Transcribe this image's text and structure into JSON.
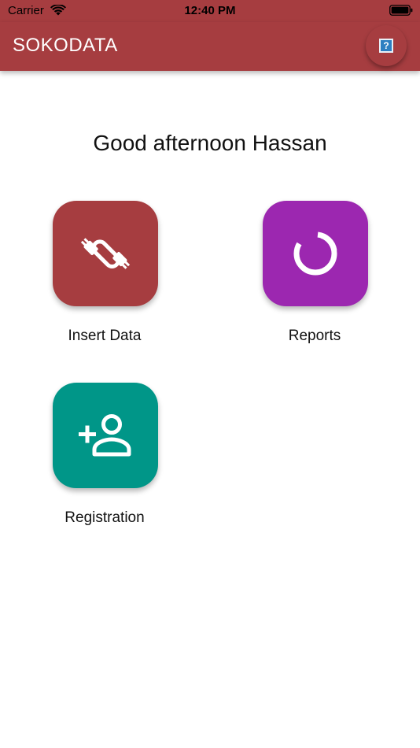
{
  "status_bar": {
    "carrier": "Carrier",
    "time": "12:40 PM",
    "icons": [
      "wifi-icon",
      "battery-icon"
    ]
  },
  "app_bar": {
    "title": "SOKODATA",
    "help_icon": "help-icon",
    "help_glyph": "?",
    "color": "#a63d40"
  },
  "greeting": "Good afternoon Hassan",
  "tiles": [
    {
      "label": "Insert Data",
      "icon": "cable-icon",
      "color": "#a63d40"
    },
    {
      "label": "Reports",
      "icon": "donut-chart-icon",
      "color": "#9c27b0"
    },
    {
      "label": "Registration",
      "icon": "add-person-icon",
      "color": "#009688"
    }
  ]
}
